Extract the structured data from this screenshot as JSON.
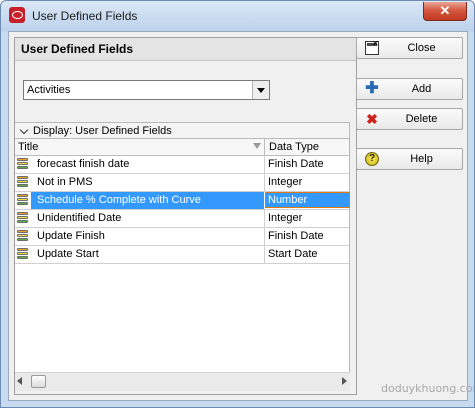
{
  "window": {
    "title": "User Defined Fields",
    "close_glyph": "✕"
  },
  "panel": {
    "header": "User Defined Fields"
  },
  "subject_area": {
    "selected": "Activities"
  },
  "display_bar": {
    "label": "Display: User Defined Fields"
  },
  "grid": {
    "columns": [
      "Title",
      "Data Type"
    ],
    "rows": [
      {
        "title": "forecast finish date",
        "type": "Finish Date"
      },
      {
        "title": "Not in PMS",
        "type": "Integer"
      },
      {
        "title": "Schedule % Complete with Curve",
        "type": "Number",
        "selected": true
      },
      {
        "title": "Unidentified Date",
        "type": "Integer"
      },
      {
        "title": "Update Finish",
        "type": "Finish Date"
      },
      {
        "title": "Update Start",
        "type": "Start Date"
      }
    ]
  },
  "buttons": {
    "close": "Close",
    "add": "Add",
    "delete": "Delete",
    "help": "Help"
  },
  "icons": {
    "add": "✚",
    "delete": "✖",
    "help": "?"
  },
  "watermark": "doduykhuong.com",
  "colors": {
    "selection": "#3399ff",
    "focus_border": "#e07a10",
    "title_close": "#c7422a"
  }
}
